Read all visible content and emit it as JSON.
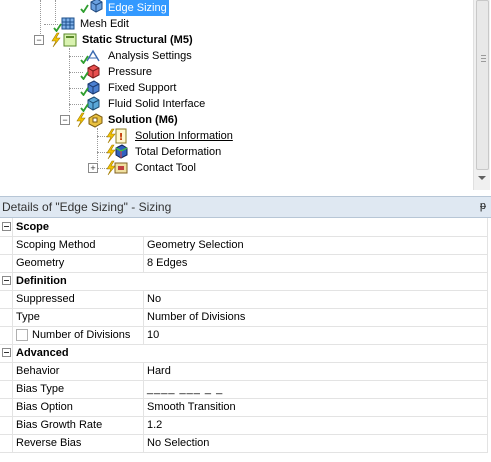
{
  "tree": {
    "nodes": [
      {
        "id": "edge-sizing",
        "label": "Edge Sizing",
        "selected": true,
        "bold": false,
        "underline": false
      },
      {
        "id": "mesh-edit",
        "label": "Mesh Edit",
        "bold": false
      },
      {
        "id": "static-structural",
        "label": "Static Structural (M5)",
        "bold": true
      },
      {
        "id": "analysis-settings",
        "label": "Analysis Settings",
        "bold": false
      },
      {
        "id": "pressure",
        "label": "Pressure",
        "bold": false
      },
      {
        "id": "fixed-support",
        "label": "Fixed Support",
        "bold": false
      },
      {
        "id": "fluid-solid-interface",
        "label": "Fluid Solid Interface",
        "bold": false
      },
      {
        "id": "solution",
        "label": "Solution (M6)",
        "bold": true
      },
      {
        "id": "solution-information",
        "label": "Solution Information",
        "underline": true
      },
      {
        "id": "total-deformation",
        "label": "Total Deformation",
        "bold": false
      },
      {
        "id": "contact-tool",
        "label": "Contact Tool",
        "bold": false
      }
    ],
    "icons": {
      "edge-sizing": "edge-sizing-icon",
      "mesh-edit": "mesh-edit-icon",
      "static-structural": "static-structural-icon",
      "analysis-settings": "analysis-settings-icon",
      "pressure": "pressure-icon",
      "fixed-support": "fixed-support-icon",
      "fluid-solid-interface": "fluid-solid-interface-icon",
      "solution": "solution-icon",
      "solution-information": "solution-information-icon",
      "total-deformation": "total-deformation-icon",
      "contact-tool": "contact-tool-icon"
    }
  },
  "details": {
    "title": "Details of \"Edge Sizing\" - Sizing",
    "pin_glyph": "ᵽ",
    "groups": [
      {
        "label": "Scope",
        "rows": [
          {
            "key": "Scoping Method",
            "value": "Geometry Selection"
          },
          {
            "key": "Geometry",
            "value": "8 Edges"
          }
        ]
      },
      {
        "label": "Definition",
        "rows": [
          {
            "key": "Suppressed",
            "value": "No"
          },
          {
            "key": "Type",
            "value": "Number of Divisions"
          },
          {
            "key": "Number of Divisions",
            "value": "10",
            "parameter_checkbox": true
          }
        ]
      },
      {
        "label": "Advanced",
        "rows": [
          {
            "key": "Behavior",
            "value": "Hard"
          },
          {
            "key": "Bias Type",
            "value": "____ ___ _ _",
            "bias_graphic": true
          },
          {
            "key": "Bias Option",
            "value": "Smooth Transition"
          },
          {
            "key": "Bias Growth Rate",
            "value": "1.2"
          },
          {
            "key": "Reverse Bias",
            "value": "No Selection"
          }
        ]
      }
    ]
  },
  "colors": {
    "selection": "#3399ff",
    "header_bg": "#dfe8f2",
    "check_green": "#2e9e2e",
    "lightning_yellow": "#f2c200"
  }
}
